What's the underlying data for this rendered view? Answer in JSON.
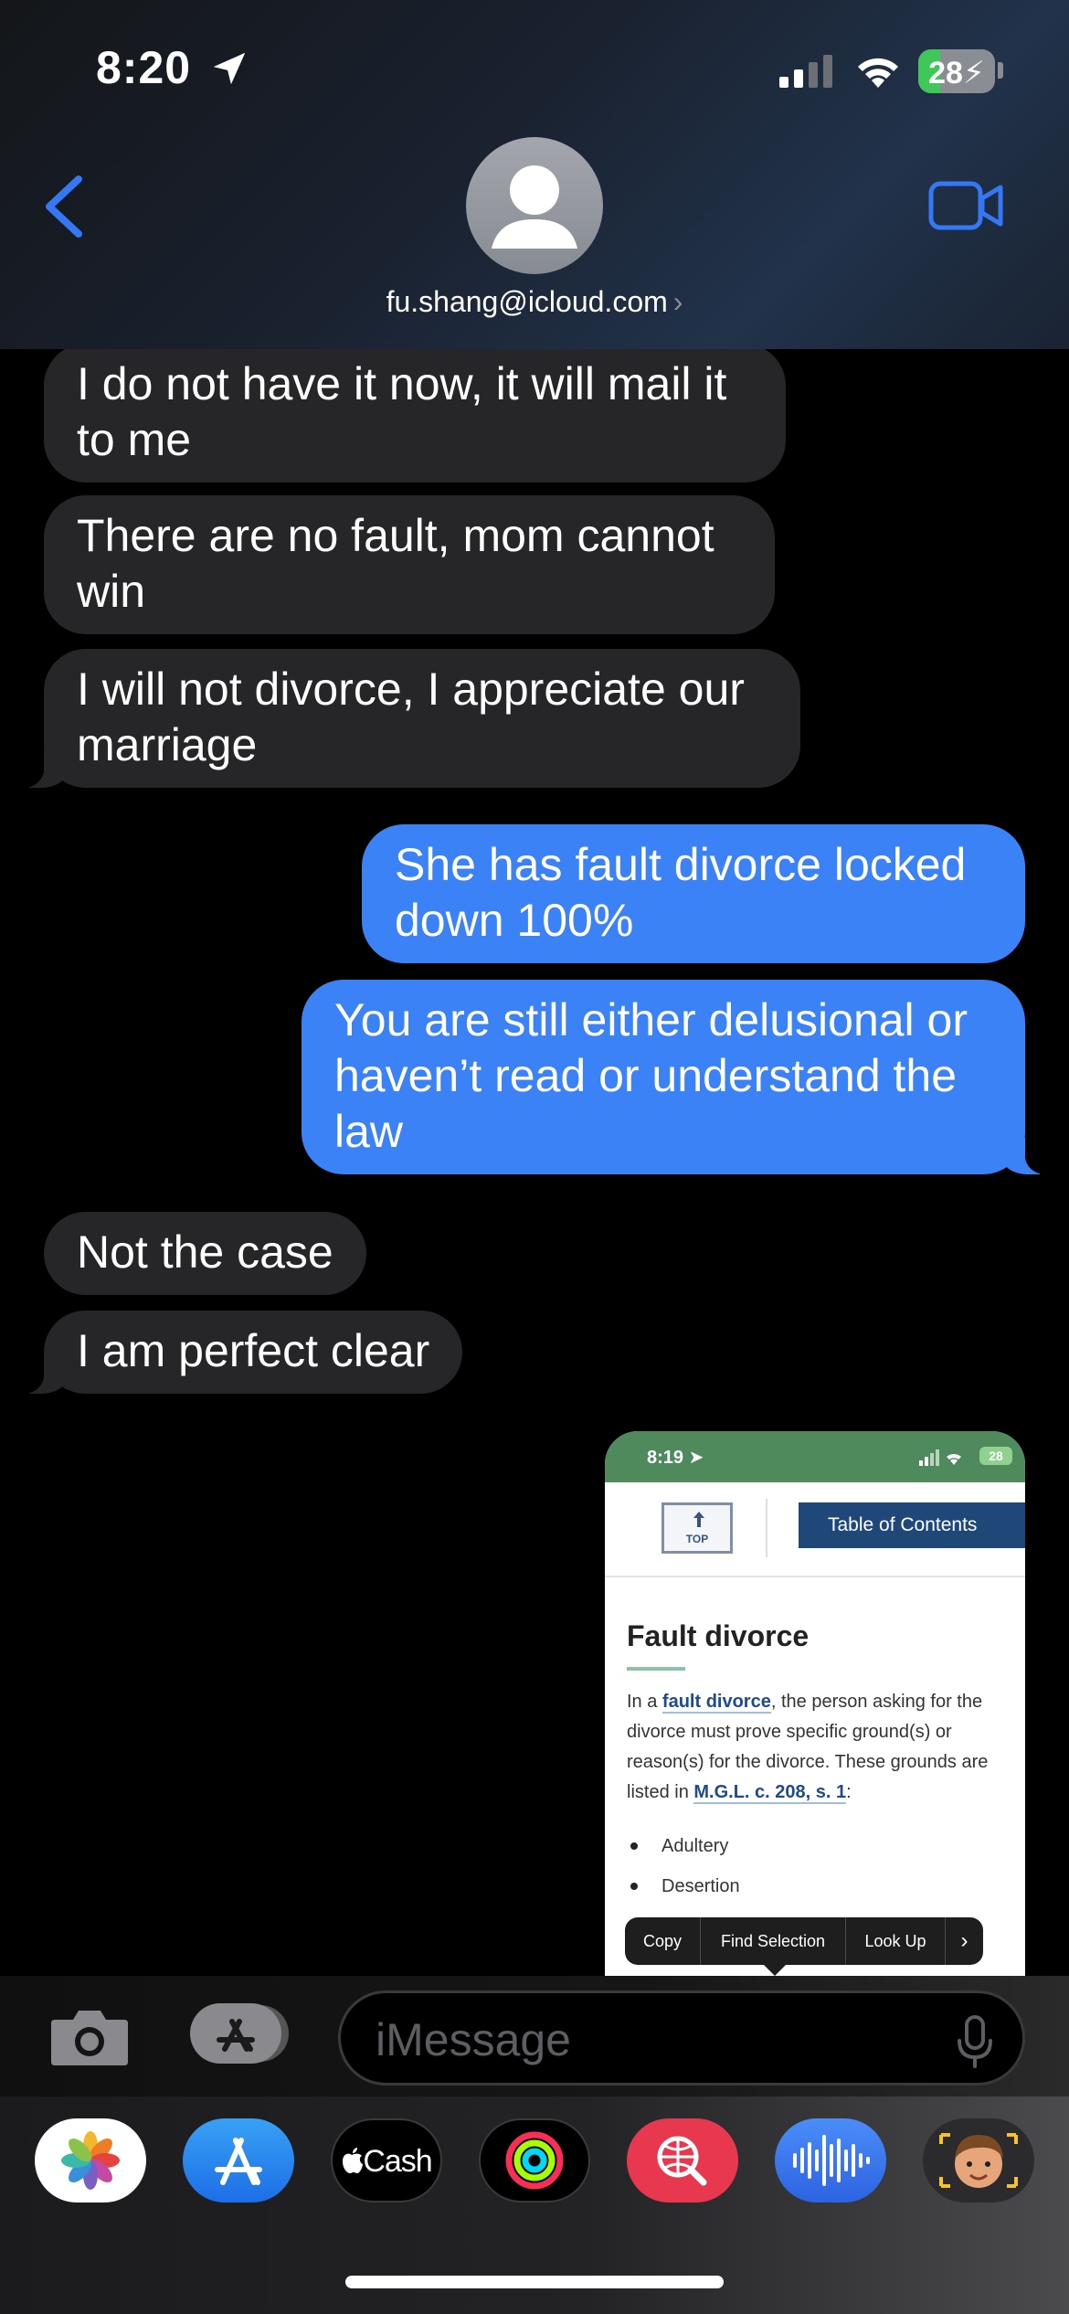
{
  "status_bar": {
    "time": "8:20",
    "battery_level": "28",
    "battery_percent": 28,
    "icons": [
      "location-arrow-icon",
      "cellular-signal-icon",
      "wifi-icon",
      "battery-charging-icon"
    ]
  },
  "header": {
    "contact": "fu.shang@icloud.com",
    "chevron": "›"
  },
  "messages": [
    {
      "direction": "incoming",
      "text": "I do not have it now, it will mail it to me"
    },
    {
      "direction": "incoming",
      "text": "There are no fault, mom cannot win"
    },
    {
      "direction": "incoming",
      "text": "I will not divorce, I appreciate our marriage"
    },
    {
      "direction": "outgoing",
      "text": "She has fault divorce locked down 100%"
    },
    {
      "direction": "outgoing",
      "text": "You are still either delusional or haven’t read or understand the law"
    },
    {
      "direction": "incoming",
      "text": "Not the case"
    },
    {
      "direction": "incoming",
      "text": "I am perfect clear"
    }
  ],
  "attachment": {
    "status_time": "8:19",
    "battery": "28",
    "top_button": "TOP",
    "toc_button": "Table of Contents",
    "title": "Fault divorce",
    "para_1": "In a ",
    "link_1": "fault divorce",
    "para_2": ", the person asking for the divorce must prove specific ground(s) or reason(s) for the divorce. These grounds are listed in ",
    "link_2": "M.G.L. c. 208, s. 1",
    "para_3": ":",
    "list": [
      "Adultery",
      "Desertion"
    ],
    "menu": {
      "copy": "Copy",
      "find": "Find Selection",
      "lookup": "Look Up",
      "more": "›"
    }
  },
  "input": {
    "placeholder": "iMessage"
  },
  "drawer": {
    "apps": [
      "photos-app-icon",
      "app-store-app-icon",
      "apple-cash-app-icon",
      "fitness-app-icon",
      "web-search-app-icon",
      "audio-message-app-icon",
      "memoji-app-icon"
    ],
    "cash_label": "Cash"
  },
  "colors": {
    "outgoing_bubble": "#3b82f6",
    "incoming_bubble": "#262628",
    "accent": "#3478f6"
  }
}
